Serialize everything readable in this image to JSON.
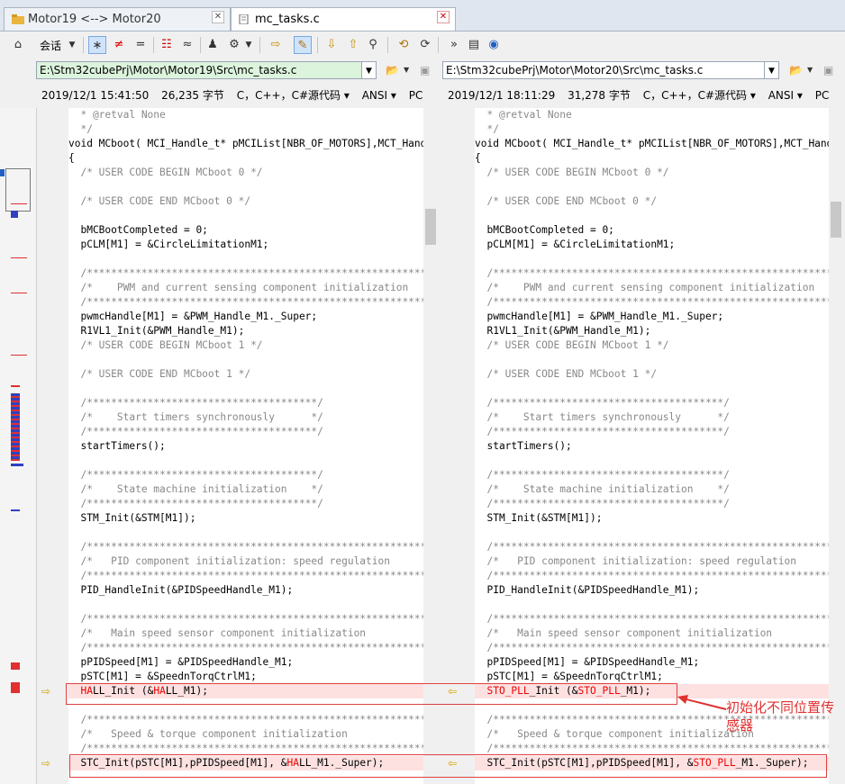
{
  "tabs": [
    {
      "label": "Motor19 <--> Motor20",
      "active": false
    },
    {
      "label": "mc_tasks.c",
      "active": true
    }
  ],
  "toolbar": {
    "session_label": "会话"
  },
  "left": {
    "path": "E:\\Stm32cubePrj\\Motor\\Motor19\\Src\\mc_tasks.c",
    "date": "2019/12/1 15:41:50",
    "size": "26,235 字节",
    "format": "C，C++，C#源代码",
    "encoding": "ANSI",
    "eol": "PC"
  },
  "right": {
    "path": "E:\\Stm32cubePrj\\Motor\\Motor20\\Src\\mc_tasks.c",
    "date": "2019/12/1 18:11:29",
    "size": "31,278 字节",
    "format": "C，C++，C#源代码",
    "encoding": "ANSI",
    "eol": "PC"
  },
  "code_common": [
    "  * @retval None",
    "  */",
    "void MCboot( MCI_Handle_t* pMCIList[NBR_OF_MOTORS],MCT_Handle_t* pMCTList[NBR_OF_MOTORS] )",
    "{",
    "  /* USER CODE BEGIN MCboot 0 */",
    "",
    "  /* USER CODE END MCboot 0 */",
    "",
    "  bMCBootCompleted = 0;",
    "  pCLM[M1] = &CircleLimitationM1;",
    "",
    "  /**********************************************************/",
    "  /*    PWM and current sensing component initialization    */",
    "  /**********************************************************/",
    "  pwmcHandle[M1] = &PWM_Handle_M1._Super;",
    "  R1VL1_Init(&PWM_Handle_M1);",
    "  /* USER CODE BEGIN MCboot 1 */",
    "",
    "  /* USER CODE END MCboot 1 */",
    "",
    "  /**************************************/",
    "  /*    Start timers synchronously      */",
    "  /**************************************/",
    "  startTimers();",
    "",
    "  /**************************************/",
    "  /*    State machine initialization    */",
    "  /**************************************/",
    "  STM_Init(&STM[M1]);",
    "",
    "  /**********************************************************/",
    "  /*   PID component initialization: speed regulation       */",
    "  /**********************************************************/",
    "  PID_HandleInit(&PIDSpeedHandle_M1);",
    "",
    "  /**********************************************************/",
    "  /*   Main speed sensor component initialization           */",
    "  /**********************************************************/",
    "  pPIDSpeed[M1] = &PIDSpeedHandle_M1;",
    "  pSTC[M1] = &SpeednTorqCtrlM1;"
  ],
  "diff1": {
    "left": {
      "a": "  ",
      "b": "HA",
      "c": "LL_Init (&",
      "d": "HA",
      "e": "LL_M1);"
    },
    "right": {
      "a": "  ",
      "b": "STO_PLL",
      "c": "_Init (&",
      "d": "STO_PLL",
      "e": "_M1);"
    }
  },
  "code_common2": [
    "",
    "  /**********************************************************/",
    "  /*   Speed & torque component initialization              */",
    "  /**********************************************************/"
  ],
  "diff2": {
    "left": {
      "a": "  STC_Init(pSTC[M1],pPIDSpeed[M1], &",
      "b": "HA",
      "c": "LL_M1._Super);"
    },
    "right": {
      "a": "  STC_Init(pSTC[M1],pPIDSpeed[M1], &",
      "b": "STO_PLL",
      "c": "_M1._Super);"
    }
  },
  "annotation": "初始化不同位置传感器",
  "colors": {
    "diff_bg": "#fde1e1",
    "diff_text": "#e00000",
    "annot": "#e03030"
  }
}
